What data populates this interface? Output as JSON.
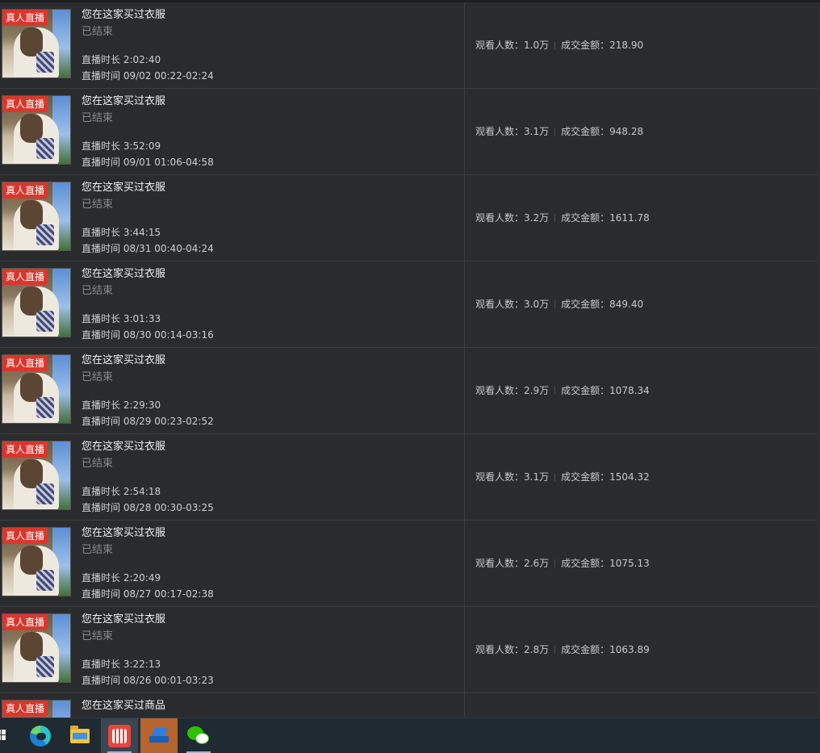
{
  "list": {
    "badge_label": "真人直播",
    "viewers_label": "观看人数：",
    "sales_label": "成交金额：",
    "duration_label": "直播时长",
    "time_label": "直播时间",
    "rows": [
      {
        "title": "您在这家买过衣服",
        "status": "已结束",
        "duration": "2:02:40",
        "time": "09/02 00:22-02:24",
        "viewers": "1.0万",
        "sales": "218.90"
      },
      {
        "title": "您在这家买过衣服",
        "status": "已结束",
        "duration": "3:52:09",
        "time": "09/01 01:06-04:58",
        "viewers": "3.1万",
        "sales": "948.28"
      },
      {
        "title": "您在这家买过衣服",
        "status": "已结束",
        "duration": "3:44:15",
        "time": "08/31 00:40-04:24",
        "viewers": "3.2万",
        "sales": "1611.78"
      },
      {
        "title": "您在这家买过衣服",
        "status": "已结束",
        "duration": "3:01:33",
        "time": "08/30 00:14-03:16",
        "viewers": "3.0万",
        "sales": "849.40"
      },
      {
        "title": "您在这家买过衣服",
        "status": "已结束",
        "duration": "2:29:30",
        "time": "08/29 00:23-02:52",
        "viewers": "2.9万",
        "sales": "1078.34"
      },
      {
        "title": "您在这家买过衣服",
        "status": "已结束",
        "duration": "2:54:18",
        "time": "08/28 00:30-03:25",
        "viewers": "3.1万",
        "sales": "1504.32"
      },
      {
        "title": "您在这家买过衣服",
        "status": "已结束",
        "duration": "2:20:49",
        "time": "08/27 00:17-02:38",
        "viewers": "2.6万",
        "sales": "1075.13"
      },
      {
        "title": "您在这家买过衣服",
        "status": "已结束",
        "duration": "3:22:13",
        "time": "08/26 00:01-03:23",
        "viewers": "2.8万",
        "sales": "1063.89"
      },
      {
        "title": "您在这家买过商品",
        "status": "",
        "duration": "",
        "time": "",
        "viewers": "",
        "sales": ""
      }
    ]
  },
  "taskbar": {
    "items": [
      "windows-start-icon",
      "edge-browser-icon",
      "file-explorer-icon",
      "live-app-icon",
      "app-icon",
      "wechat-icon"
    ]
  }
}
